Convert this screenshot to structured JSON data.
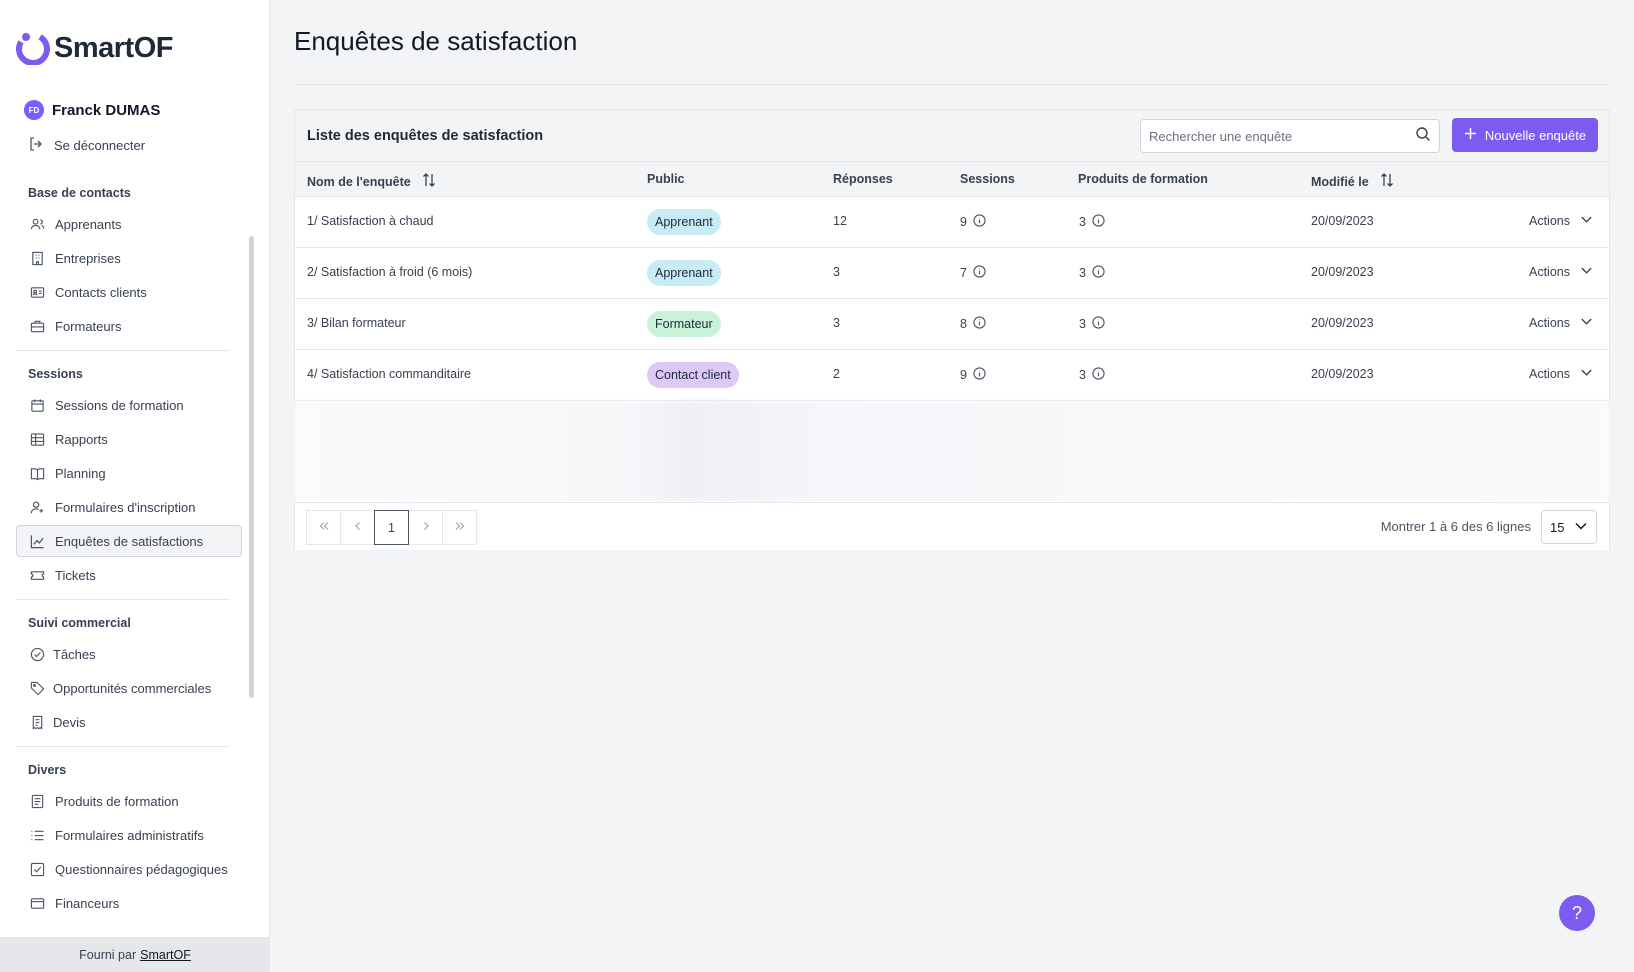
{
  "brand": {
    "name": "SmartOF",
    "accent": "#7c5cf0"
  },
  "user": {
    "initials": "FD",
    "name": "Franck DUMAS",
    "logout_label": "Se déconnecter"
  },
  "sidebar": {
    "groups": [
      {
        "title": "Base de contacts",
        "items": [
          {
            "label": "Apprenants",
            "icon": "users-icon"
          },
          {
            "label": "Entreprises",
            "icon": "building-icon"
          },
          {
            "label": "Contacts clients",
            "icon": "id-card-icon"
          },
          {
            "label": "Formateurs",
            "icon": "briefcase-icon"
          }
        ]
      },
      {
        "title": "Sessions",
        "items": [
          {
            "label": "Sessions de formation",
            "icon": "calendar-icon"
          },
          {
            "label": "Rapports",
            "icon": "table-icon"
          },
          {
            "label": "Planning",
            "icon": "book-icon"
          },
          {
            "label": "Formulaires d'inscription",
            "icon": "user-plus-icon"
          },
          {
            "label": "Enquêtes de satisfactions",
            "icon": "chart-line-icon",
            "active": true
          },
          {
            "label": "Tickets",
            "icon": "ticket-icon"
          }
        ]
      },
      {
        "title": "Suivi commercial",
        "items": [
          {
            "label": "Tâches",
            "icon": "check-circle-icon"
          },
          {
            "label": "Opportunités commerciales",
            "icon": "tag-icon"
          },
          {
            "label": "Devis",
            "icon": "receipt-icon"
          }
        ]
      },
      {
        "title": "Divers",
        "items": [
          {
            "label": "Produits de formation",
            "icon": "document-icon"
          },
          {
            "label": "Formulaires administratifs",
            "icon": "list-icon"
          },
          {
            "label": "Questionnaires pédagogiques",
            "icon": "check-square-icon"
          },
          {
            "label": "Financeurs",
            "icon": "wallet-icon"
          }
        ]
      }
    ]
  },
  "footer": {
    "prefix": "Fourni par",
    "link": "SmartOF"
  },
  "page": {
    "title": "Enquêtes de satisfaction"
  },
  "card": {
    "title": "Liste des enquêtes de satisfaction",
    "search_placeholder": "Rechercher une enquête",
    "new_button": "Nouvelle enquête"
  },
  "table": {
    "columns": {
      "name": "Nom de l'enquête",
      "public": "Public",
      "responses": "Réponses",
      "sessions": "Sessions",
      "products": "Produits de formation",
      "modified": "Modifié le"
    },
    "rows": [
      {
        "name": "1/ Satisfaction à chaud",
        "public": "Apprenant",
        "public_color": "#c7ecf5",
        "responses": "12",
        "sessions": "9",
        "products": "3",
        "modified": "20/09/2023",
        "actions": "Actions"
      },
      {
        "name": "2/ Satisfaction à froid (6 mois)",
        "public": "Apprenant",
        "public_color": "#c7ecf5",
        "responses": "3",
        "sessions": "7",
        "products": "3",
        "modified": "20/09/2023",
        "actions": "Actions"
      },
      {
        "name": "3/ Bilan formateur",
        "public": "Formateur",
        "public_color": "#c9f3d9",
        "responses": "3",
        "sessions": "8",
        "products": "3",
        "modified": "20/09/2023",
        "actions": "Actions"
      },
      {
        "name": "4/ Satisfaction commanditaire",
        "public": "Contact client",
        "public_color": "#dcc9f5",
        "responses": "2",
        "sessions": "9",
        "products": "3",
        "modified": "20/09/2023",
        "actions": "Actions"
      }
    ]
  },
  "pagination": {
    "current_page": "1",
    "info": "Montrer 1 à 6 des 6 lignes",
    "per_page": "15"
  },
  "help": {
    "label": "?"
  }
}
